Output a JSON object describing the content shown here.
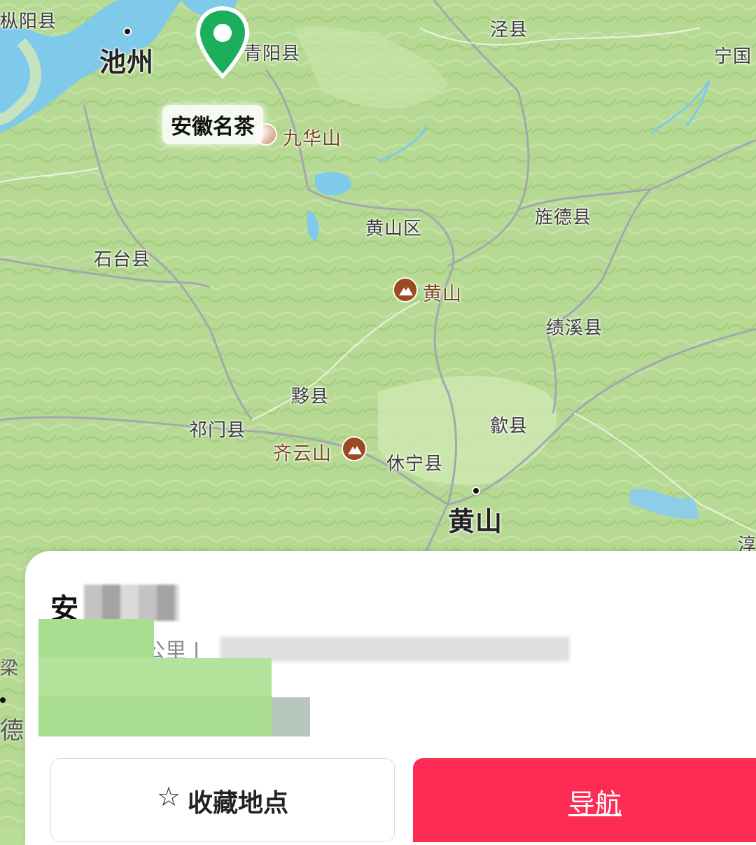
{
  "map": {
    "labels": {
      "zongyang": "枞阳县",
      "chizhou": "池州",
      "qingyang": "青阳县",
      "jingxian": "泾县",
      "ningguo": "宁国",
      "jiuhuashan": "九华山",
      "huangshanqu": "黄山区",
      "jingdexian": "旌德县",
      "shitaixian": "石台县",
      "huangshan_scenic": "黄山",
      "jixixian": "绩溪县",
      "yixian": "黟县",
      "qimenxian": "祁门县",
      "shexian": "歙县",
      "qiyunshan": "齐云山",
      "xiuningxian": "休宁县",
      "huangshan_city": "黄山",
      "chun": "淳",
      "liang": "梁",
      "de": "德"
    },
    "selected_poi": "安徽名茶"
  },
  "sheet": {
    "title": "安",
    "distance_text": "公里 |",
    "favorite_label": "收藏地点",
    "navigate_label": "导航",
    "accent_color": "#fe2c55"
  }
}
